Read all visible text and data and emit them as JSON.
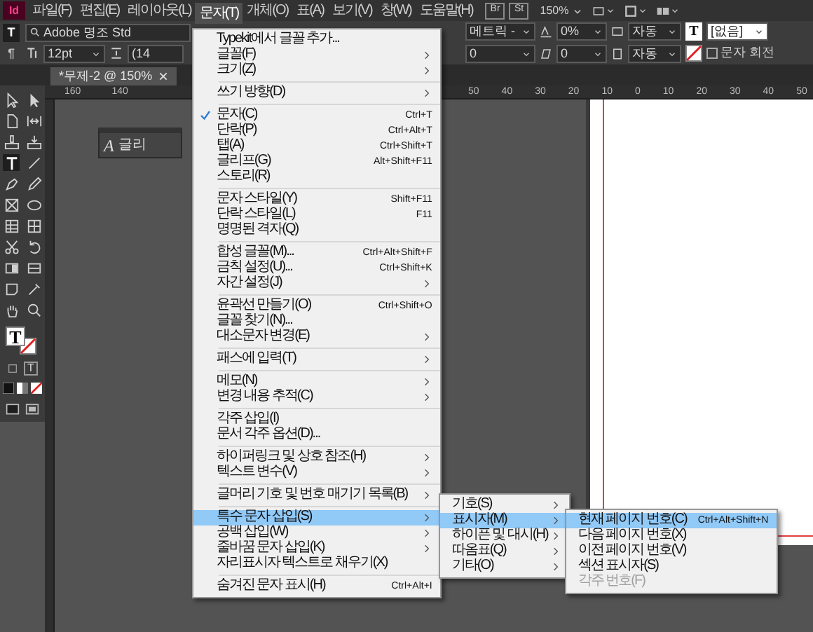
{
  "menubar": {
    "logo": "Id",
    "items": [
      {
        "label": "파일(F)",
        "selected": false
      },
      {
        "label": "편집(E)",
        "selected": false
      },
      {
        "label": "레이아웃(L)",
        "selected": false
      },
      {
        "label": "문자(T)",
        "selected": true
      },
      {
        "label": "개체(O)",
        "selected": false
      },
      {
        "label": "표(A)",
        "selected": false
      },
      {
        "label": "보기(V)",
        "selected": false
      },
      {
        "label": "창(W)",
        "selected": false
      },
      {
        "label": "도움말(H)",
        "selected": false
      }
    ],
    "apps": [
      "Br",
      "St"
    ],
    "zoom": "150%"
  },
  "control_panel": {
    "modes": [
      {
        "label": "T",
        "selected": true
      },
      {
        "label": "¶",
        "selected": false
      }
    ],
    "font": "Adobe 명조 Std",
    "size": "12pt",
    "leading": "(14",
    "kerning": "메트릭 -",
    "tracking": "0%",
    "scale": "자동",
    "baseline": "0",
    "skew": "0",
    "scale_2": "자동",
    "text_swatch": "T",
    "style": "[없음]",
    "rotate": {
      "label": "문자 회전",
      "checked": false
    }
  },
  "document_tab": {
    "title": "*무제-2 @ 150%"
  },
  "ruler": {
    "left_labels": [
      "160",
      "140"
    ],
    "right_labels": [
      "50",
      "40",
      "30",
      "20",
      "10",
      "0",
      "10",
      "20",
      "30",
      "40",
      "50"
    ]
  },
  "toolbox": {
    "fill_glyph": "T",
    "formatting_glyph": "T"
  },
  "glyph_panel": {
    "glyph": "A",
    "title": "글리"
  },
  "menu": {
    "groups": [
      {
        "items": [
          {
            "label": "Typekit에서 글꼴 추가...",
            "submenu": false,
            "checked": false,
            "selected": false
          },
          {
            "label": "글꼴(F)",
            "submenu": true,
            "checked": false,
            "selected": false
          },
          {
            "label": "크기(Z)",
            "submenu": true,
            "checked": false,
            "selected": false
          }
        ]
      },
      {
        "items": [
          {
            "label": "쓰기 방향(D)",
            "submenu": true,
            "checked": false,
            "selected": false
          }
        ]
      },
      {
        "items": [
          {
            "label": "문자(C)",
            "shortcut": "Ctrl+T",
            "submenu": false,
            "checked": true,
            "selected": false
          },
          {
            "label": "단락(P)",
            "shortcut": "Ctrl+Alt+T",
            "submenu": false,
            "checked": false,
            "selected": false
          },
          {
            "label": "탭(A)",
            "shortcut": "Ctrl+Shift+T",
            "submenu": false,
            "checked": false,
            "selected": false
          },
          {
            "label": "글리프(G)",
            "shortcut": "Alt+Shift+F11",
            "submenu": false,
            "checked": false,
            "selected": false
          },
          {
            "label": "스토리(R)",
            "submenu": false,
            "checked": false,
            "selected": false
          }
        ]
      },
      {
        "items": [
          {
            "label": "문자 스타일(Y)",
            "shortcut": "Shift+F11",
            "submenu": false,
            "checked": false,
            "selected": false
          },
          {
            "label": "단락 스타일(L)",
            "shortcut": "F11",
            "submenu": false,
            "checked": false,
            "selected": false
          },
          {
            "label": "명명된 격자(Q)",
            "submenu": false,
            "checked": false,
            "selected": false
          }
        ]
      },
      {
        "items": [
          {
            "label": "합성 글꼴(M)...",
            "shortcut": "Ctrl+Alt+Shift+F",
            "submenu": false,
            "checked": false,
            "selected": false
          },
          {
            "label": "금칙 설정(U)...",
            "shortcut": "Ctrl+Shift+K",
            "submenu": false,
            "checked": false,
            "selected": false
          },
          {
            "label": "자간 설정(J)",
            "submenu": true,
            "checked": false,
            "selected": false
          }
        ]
      },
      {
        "items": [
          {
            "label": "윤곽선 만들기(O)",
            "shortcut": "Ctrl+Shift+O",
            "submenu": false,
            "checked": false,
            "selected": false
          },
          {
            "label": "글꼴 찾기(N)...",
            "submenu": false,
            "checked": false,
            "selected": false
          },
          {
            "label": "대소문자 변경(E)",
            "submenu": true,
            "checked": false,
            "selected": false
          }
        ]
      },
      {
        "items": [
          {
            "label": "패스에 입력(T)",
            "submenu": true,
            "checked": false,
            "selected": false
          }
        ]
      },
      {
        "items": [
          {
            "label": "메모(N)",
            "submenu": true,
            "checked": false,
            "selected": false
          },
          {
            "label": "변경 내용 추적(C)",
            "submenu": true,
            "checked": false,
            "selected": false
          }
        ]
      },
      {
        "items": [
          {
            "label": "각주 삽입(I)",
            "submenu": false,
            "checked": false,
            "selected": false
          },
          {
            "label": "문서 각주 옵션(D)...",
            "submenu": false,
            "checked": false,
            "selected": false
          }
        ]
      },
      {
        "items": [
          {
            "label": "하이퍼링크 및 상호 참조(H)",
            "submenu": true,
            "checked": false,
            "selected": false
          },
          {
            "label": "텍스트 변수(V)",
            "submenu": true,
            "checked": false,
            "selected": false
          }
        ]
      },
      {
        "items": [
          {
            "label": "글머리 기호 및 번호 매기기 목록(B)",
            "submenu": true,
            "checked": false,
            "selected": false
          }
        ]
      },
      {
        "items": [
          {
            "label": "특수 문자 삽입(S)",
            "submenu": true,
            "checked": false,
            "selected": true
          },
          {
            "label": "공백 삽입(W)",
            "submenu": true,
            "checked": false,
            "selected": false
          },
          {
            "label": "줄바꿈 문자 삽입(K)",
            "submenu": true,
            "checked": false,
            "selected": false
          },
          {
            "label": "자리표시자 텍스트로 채우기(X)",
            "submenu": false,
            "checked": false,
            "selected": false
          }
        ]
      },
      {
        "items": [
          {
            "label": "숨겨진 문자 표시(H)",
            "shortcut": "Ctrl+Alt+I",
            "submenu": false,
            "checked": false,
            "selected": false
          }
        ]
      }
    ]
  },
  "submenu": {
    "items": [
      {
        "label": "기호(S)",
        "selected": false
      },
      {
        "label": "표시자(M)",
        "selected": true
      },
      {
        "label": "하이픈 및 대시(H)",
        "selected": false
      },
      {
        "label": "따옴표(Q)",
        "selected": false
      },
      {
        "label": "기타(O)",
        "selected": false
      }
    ]
  },
  "sub_submenu": {
    "items": [
      {
        "label": "현재 페이지 번호(C)",
        "shortcut": "Ctrl+Alt+Shift+N",
        "selected": true,
        "disabled": false
      },
      {
        "label": "다음 페이지 번호(X)",
        "selected": false,
        "disabled": false
      },
      {
        "label": "이전 페이지 번호(V)",
        "selected": false,
        "disabled": false
      },
      {
        "label": "섹션 표시자(S)",
        "selected": false,
        "disabled": false
      },
      {
        "label": "각주 번호(F)",
        "selected": false,
        "disabled": true
      }
    ]
  }
}
